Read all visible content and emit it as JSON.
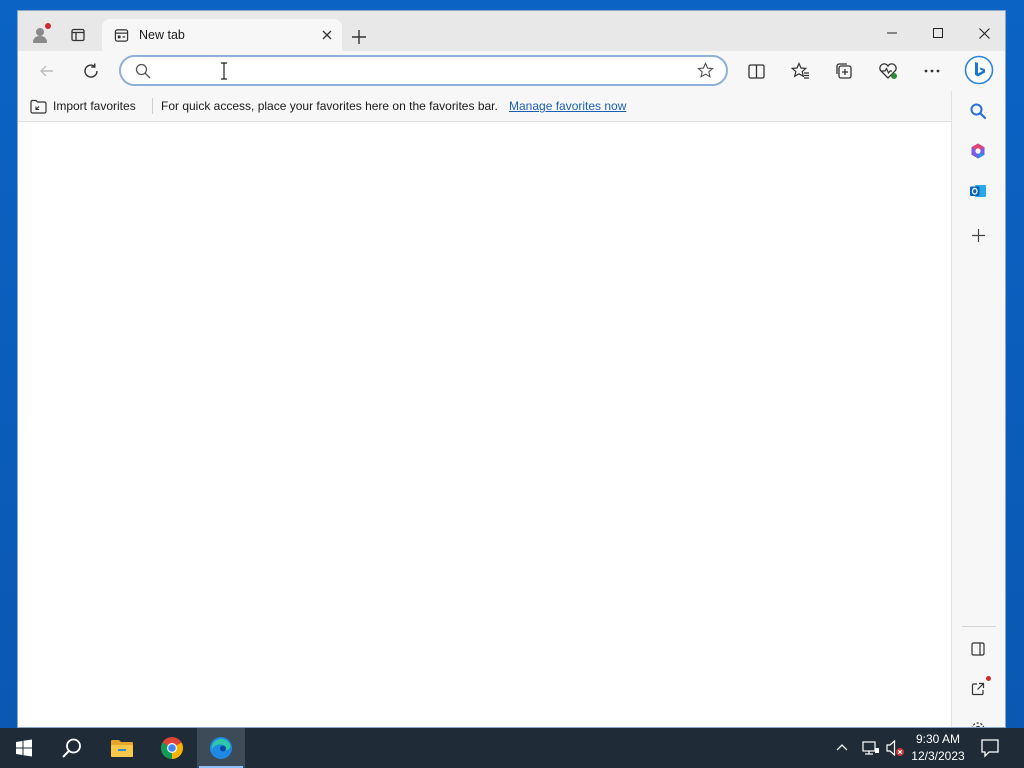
{
  "browser": {
    "tab": {
      "title": "New tab"
    },
    "address_bar": {
      "value": "",
      "placeholder": ""
    },
    "favorites_bar": {
      "import_label": "Import favorites",
      "message": "For quick access, place your favorites here on the favorites bar.",
      "manage_link": "Manage favorites now"
    },
    "toolbar_icons": [
      "back-icon",
      "refresh-icon",
      "search-icon",
      "star-icon",
      "split-screen-icon",
      "favorites-icon",
      "collections-icon",
      "browser-essentials-icon",
      "more-icon",
      "copilot-icon"
    ],
    "sidebar_icons": [
      "search-icon",
      "microsoft-365-icon",
      "outlook-icon",
      "add-icon",
      "hide-sidebar-icon",
      "open-external-icon",
      "settings-icon"
    ]
  },
  "taskbar": {
    "apps": [
      "start-icon",
      "search-icon",
      "file-explorer-icon",
      "chrome-icon",
      "edge-icon"
    ],
    "clock": {
      "time": "9:30 AM",
      "date": "12/3/2023"
    }
  },
  "colors": {
    "accent": "#1a5fb4",
    "taskbar": "#1f2c38",
    "desktop": "#0a5fb4",
    "tab_strip": "#e8e8e8"
  }
}
